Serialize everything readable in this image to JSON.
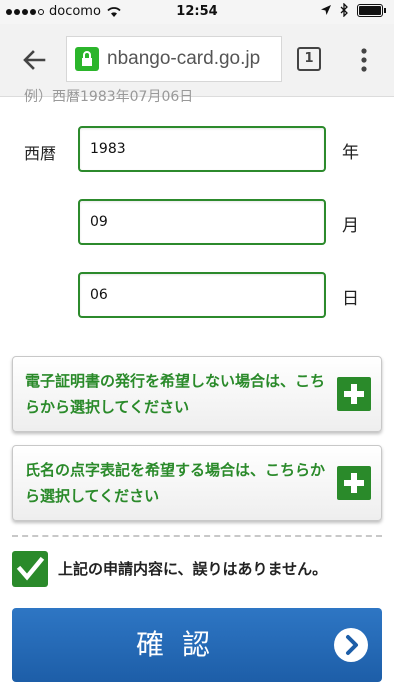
{
  "status": {
    "carrier": "docomo",
    "time": "12:54"
  },
  "browser": {
    "url": "nbango-card.go.jp",
    "tab_count": "1"
  },
  "form": {
    "cut_text": "例）西暦1983年07月06日",
    "era_label": "西暦",
    "year_value": "1983",
    "month_value": "09",
    "day_value": "06",
    "year_unit": "年",
    "month_unit": "月",
    "day_unit": "日"
  },
  "options": {
    "certificate_text": "電子証明書の発行を希望しない場合は、こちらから選択してください",
    "braille_text": "氏名の点字表記を希望する場合は、こちらから選択してください"
  },
  "confirm": {
    "checkbox_label": "上記の申請内容に、誤りはありません。",
    "checked": true
  },
  "submit": {
    "label": "確認"
  }
}
